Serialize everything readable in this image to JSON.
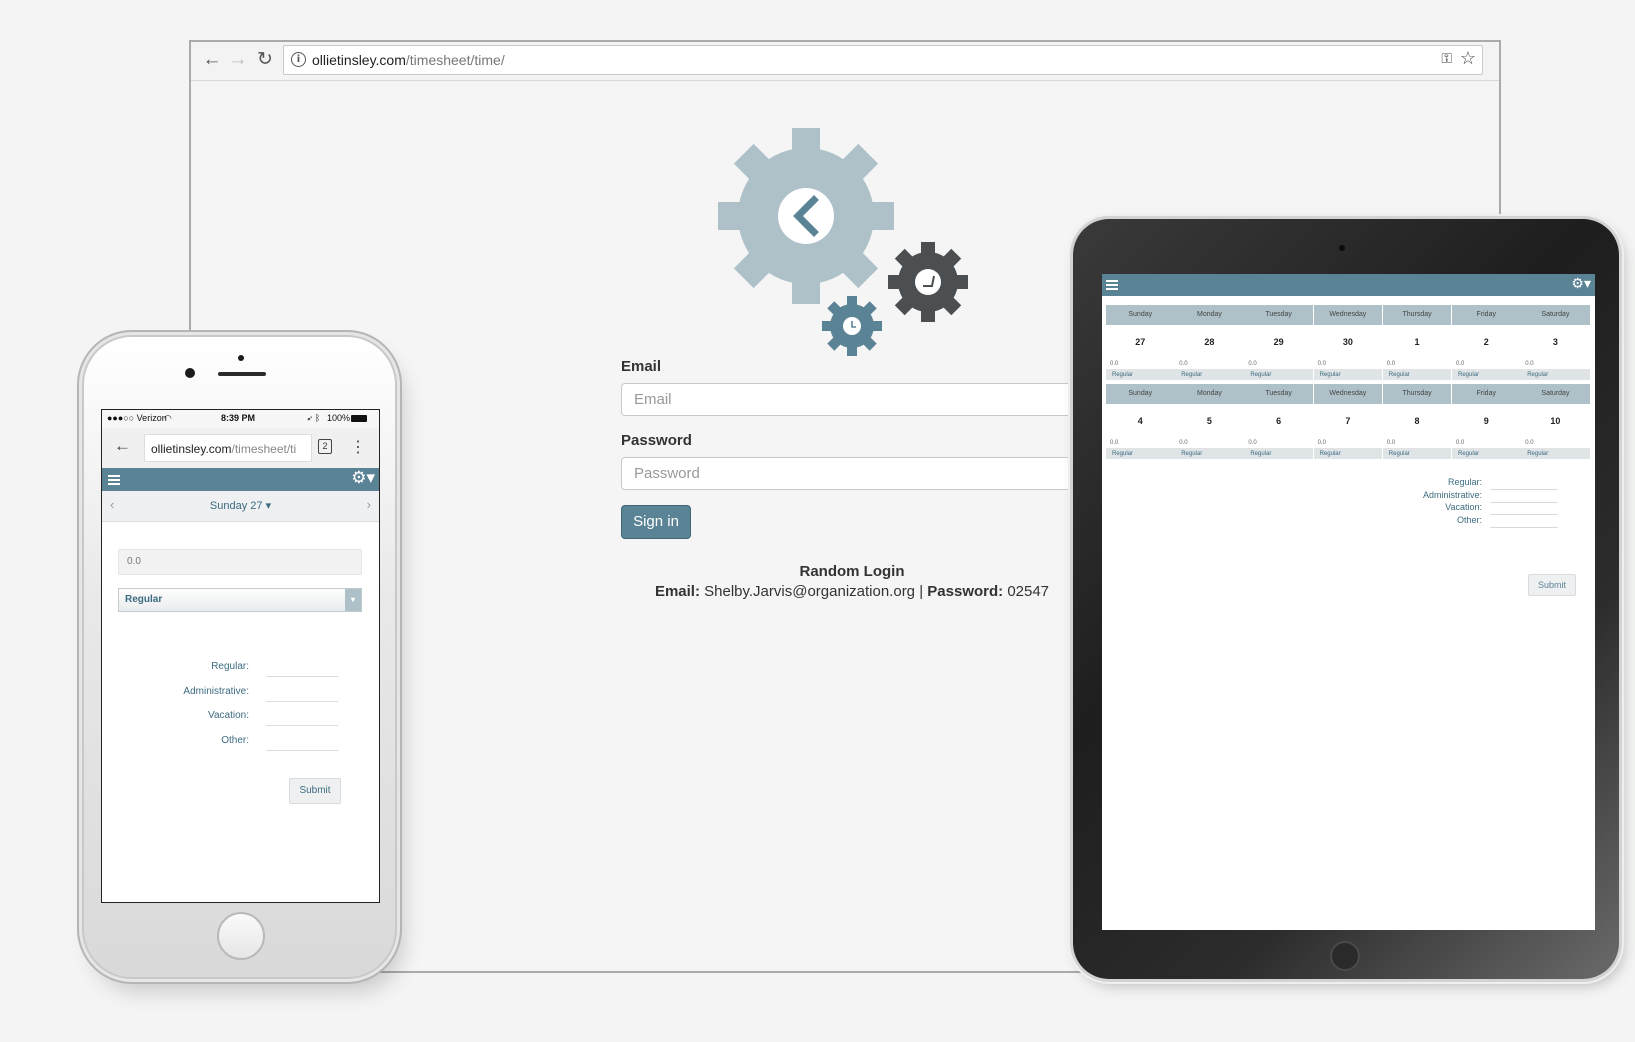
{
  "desktop": {
    "url_domain": "ollietinsley.com",
    "url_path": "/timesheet/time/",
    "login": {
      "email_label": "Email",
      "email_placeholder": "Email",
      "password_label": "Password",
      "password_placeholder": "Password",
      "signin_label": "Sign in",
      "random_title": "Random Login",
      "random_email_label": "Email:",
      "random_email": "Shelby.Jarvis@organization.org",
      "separator": "|",
      "random_password_label": "Password:",
      "random_password": "02547"
    }
  },
  "tablet": {
    "weekdays": [
      "Sunday",
      "Monday",
      "Tuesday",
      "Wednesday",
      "Thursday",
      "Friday",
      "Saturday"
    ],
    "week1_dates": [
      "27",
      "28",
      "29",
      "30",
      "1",
      "2",
      "3"
    ],
    "week2_dates": [
      "4",
      "5",
      "6",
      "7",
      "8",
      "9",
      "10"
    ],
    "hours_value": "0.0",
    "type_value": "Regular",
    "summary_labels": [
      "Regular:",
      "Administrative:",
      "Vacation:",
      "Other:"
    ],
    "submit_label": "Submit"
  },
  "phone": {
    "carrier": "●●●○○ Verizon",
    "time": "8:39 PM",
    "battery": "100%",
    "url_domain": "ollietinsley.com",
    "url_path": "/timesheet/ti",
    "tab_count": "2",
    "day_title": "Sunday 27",
    "hours_value": "0.0",
    "type_value": "Regular",
    "summary_labels": [
      "Regular:",
      "Administrative:",
      "Vacation:",
      "Other:"
    ],
    "submit_label": "Submit"
  },
  "colors": {
    "accent": "#5b8396",
    "header_light": "#aec1c9",
    "gear_large": "#aec1c9",
    "gear_dark": "#4b4f52",
    "gear_small": "#5b8396"
  }
}
